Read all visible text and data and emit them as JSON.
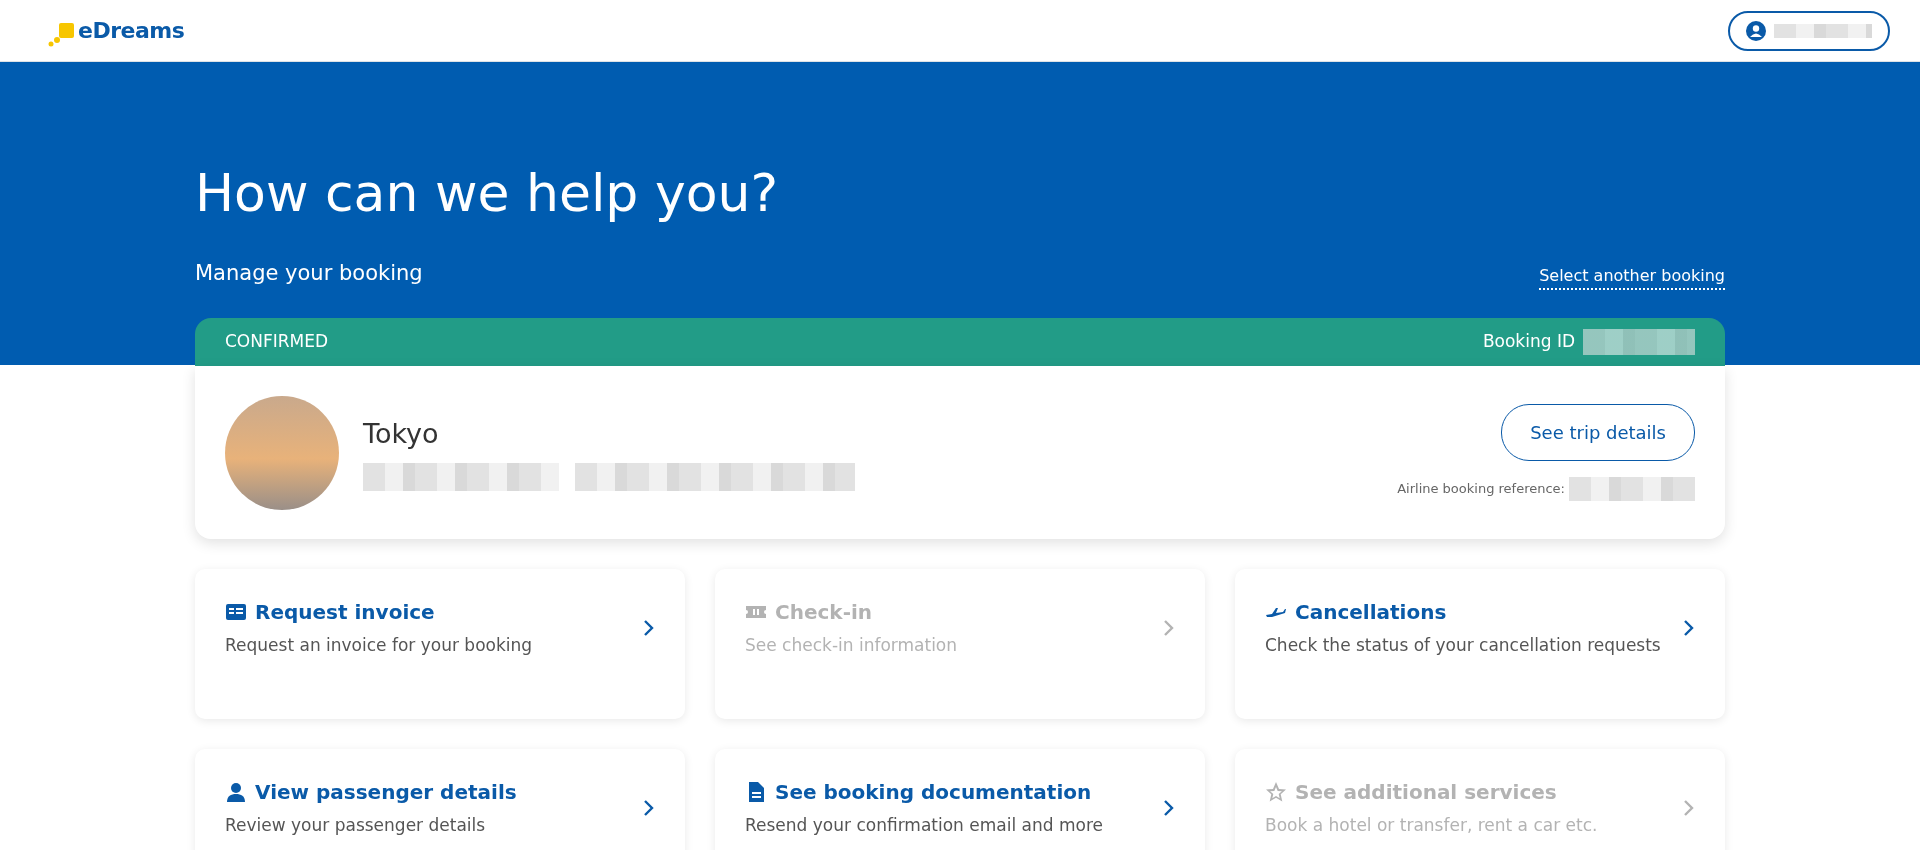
{
  "header": {
    "logo_text": "eDreams"
  },
  "hero": {
    "title": "How can we help you?",
    "section_label": "Manage your booking",
    "link": "Select another booking"
  },
  "booking": {
    "status": "CONFIRMED",
    "id_label": "Booking ID",
    "destination": "Tokyo",
    "button": "See trip details",
    "airline_ref_label": "Airline booking reference:"
  },
  "actions": [
    {
      "title": "Request invoice",
      "description": "Request an invoice for your booking",
      "disabled": false
    },
    {
      "title": "Check-in",
      "description": "See check-in information",
      "disabled": true
    },
    {
      "title": "Cancellations",
      "description": "Check the status of your cancellation requests",
      "disabled": false
    },
    {
      "title": "View passenger details",
      "description": "Review your passenger details",
      "disabled": false
    },
    {
      "title": "See booking documentation",
      "description": "Resend your confirmation email and more",
      "disabled": false
    },
    {
      "title": "See additional services",
      "description": "Book a hotel or transfer, rent a car etc.",
      "disabled": true
    }
  ]
}
